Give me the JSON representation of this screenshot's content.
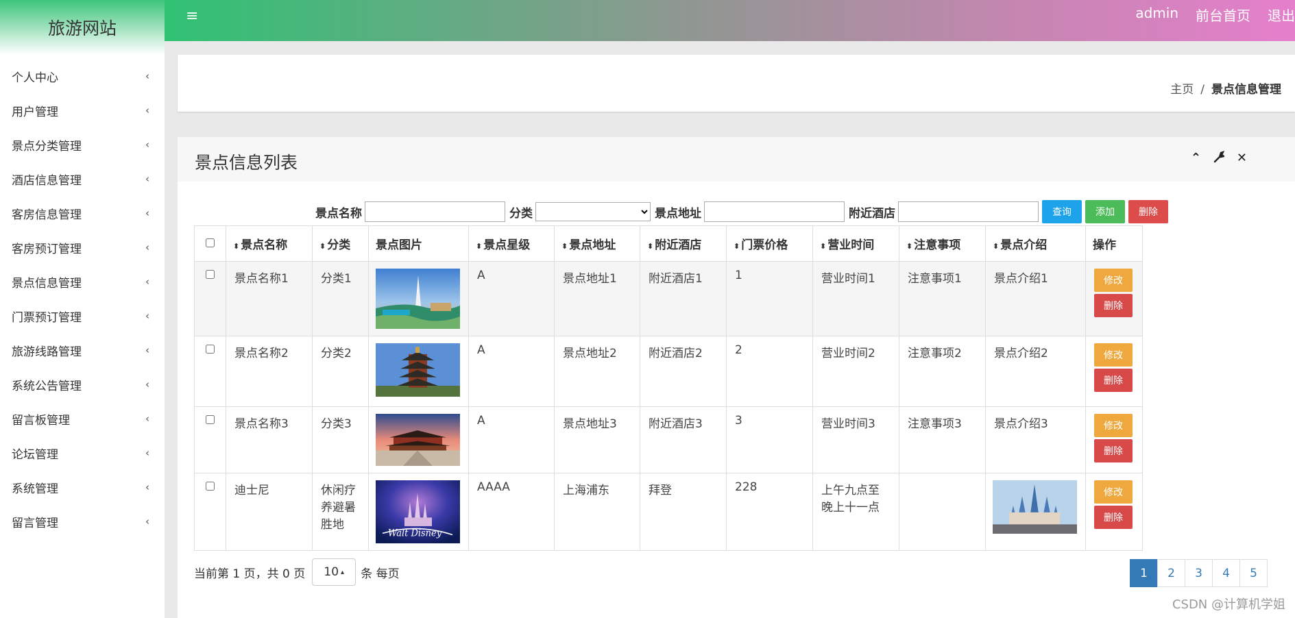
{
  "sidebar": {
    "brand": "旅游网站",
    "items": [
      {
        "label": "个人中心"
      },
      {
        "label": "用户管理"
      },
      {
        "label": "景点分类管理"
      },
      {
        "label": "酒店信息管理"
      },
      {
        "label": "客房信息管理"
      },
      {
        "label": "客房预订管理"
      },
      {
        "label": "景点信息管理"
      },
      {
        "label": "门票预订管理"
      },
      {
        "label": "旅游线路管理"
      },
      {
        "label": "系统公告管理"
      },
      {
        "label": "留言板管理"
      },
      {
        "label": "论坛管理"
      },
      {
        "label": "系统管理"
      },
      {
        "label": "留言管理"
      }
    ],
    "chevron": "‹"
  },
  "topbar": {
    "menu_icon": "≡",
    "user": "admin",
    "home_link": "前台首页",
    "logout": "退出"
  },
  "breadcrumb": {
    "home": "主页",
    "separator": "/",
    "current": "景点信息管理"
  },
  "panel": {
    "title": "景点信息列表",
    "tools": {
      "collapse": "⌃",
      "settings": "🔧",
      "close": "✕"
    }
  },
  "search": {
    "name_label": "景点名称",
    "category_label": "分类",
    "address_label": "景点地址",
    "hotel_label": "附近酒店",
    "query_btn": "查询",
    "add_btn": "添加",
    "delete_btn": "删除"
  },
  "table": {
    "headers": [
      "景点名称",
      "分类",
      "景点图片",
      "景点星级",
      "景点地址",
      "附近酒店",
      "门票价格",
      "营业时间",
      "注意事项",
      "景点介绍",
      "操作"
    ],
    "sort_icon": "⬍",
    "rows": [
      {
        "name": "景点名称1",
        "category": "分类1",
        "level": "A",
        "address": "景点地址1",
        "hotel": "附近酒店1",
        "price": "1",
        "hours": "营业时间1",
        "notes": "注意事项1",
        "intro": "景点介绍1"
      },
      {
        "name": "景点名称2",
        "category": "分类2",
        "level": "A",
        "address": "景点地址2",
        "hotel": "附近酒店2",
        "price": "2",
        "hours": "营业时间2",
        "notes": "注意事项2",
        "intro": "景点介绍2"
      },
      {
        "name": "景点名称3",
        "category": "分类3",
        "level": "A",
        "address": "景点地址3",
        "hotel": "附近酒店3",
        "price": "3",
        "hours": "营业时间3",
        "notes": "注意事项3",
        "intro": "景点介绍3"
      },
      {
        "name": "迪士尼",
        "category": "休闲疗养避暑胜地",
        "level": "AAAA",
        "address": "上海浦东",
        "hotel": "拜登",
        "price": "228",
        "hours": "上午九点至晚上十一点",
        "notes": "",
        "intro": ""
      }
    ],
    "edit_btn": "修改",
    "delete_btn": "删除"
  },
  "footer": {
    "page_info": "当前第 1 页，共 0 页",
    "page_size": "10",
    "per_page": "条 每页",
    "pages": [
      "1",
      "2",
      "3",
      "4",
      "5"
    ]
  },
  "watermark": "CSDN @计算机学姐"
}
